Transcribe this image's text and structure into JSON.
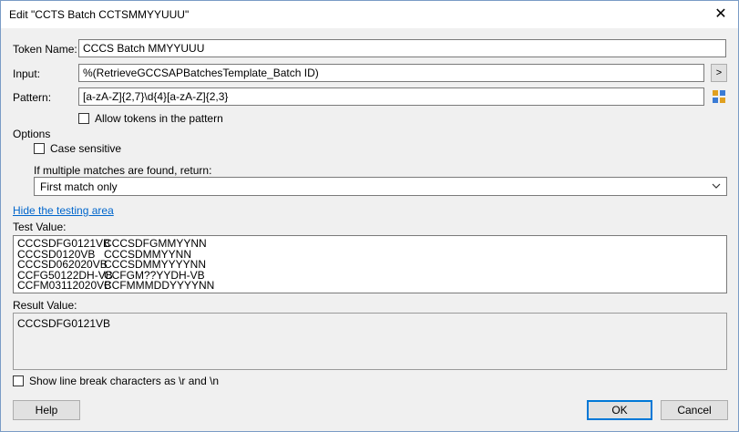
{
  "window": {
    "title": "Edit \"CCTS Batch CCTSMMYYUUU\""
  },
  "form": {
    "token_name_label": "Token Name:",
    "token_name_value": "CCCS Batch MMYYUUU",
    "input_label": "Input:",
    "input_value": "%(RetrieveGCCSAPBatchesTemplate_Batch ID)",
    "input_button": ">",
    "pattern_label": "Pattern:",
    "pattern_value": "[a-zA-Z]{2,7}\\d{4}[a-zA-Z]{2,3}",
    "allow_tokens_label": "Allow tokens in the pattern"
  },
  "options": {
    "title": "Options",
    "case_sensitive_label": "Case sensitive",
    "multiple_matches_label": "If multiple matches are found, return:",
    "multiple_matches_value": "First match only"
  },
  "testing": {
    "hide_link": "Hide the testing area",
    "test_value_label": "Test Value:",
    "test_lines": [
      [
        "CCCSDFG0121VB",
        "CCCSDFGMMYYNN"
      ],
      [
        "CCCSD0120VB",
        "CCCSDMMYYNN"
      ],
      [
        "CCCSD062020VB",
        "CCCSDMMYYYYNN"
      ],
      [
        "CCFG50122DH-VB",
        "CCFGM??YYDH-VB"
      ],
      [
        "CCFM03112020VB",
        "CCFMMMDDYYYYNN"
      ]
    ],
    "result_value_label": "Result Value:",
    "result_value": "CCCSDFG0121VB",
    "line_break_label": "Show line break characters as \\r and \\n"
  },
  "buttons": {
    "help": "Help",
    "ok": "OK",
    "cancel": "Cancel"
  }
}
